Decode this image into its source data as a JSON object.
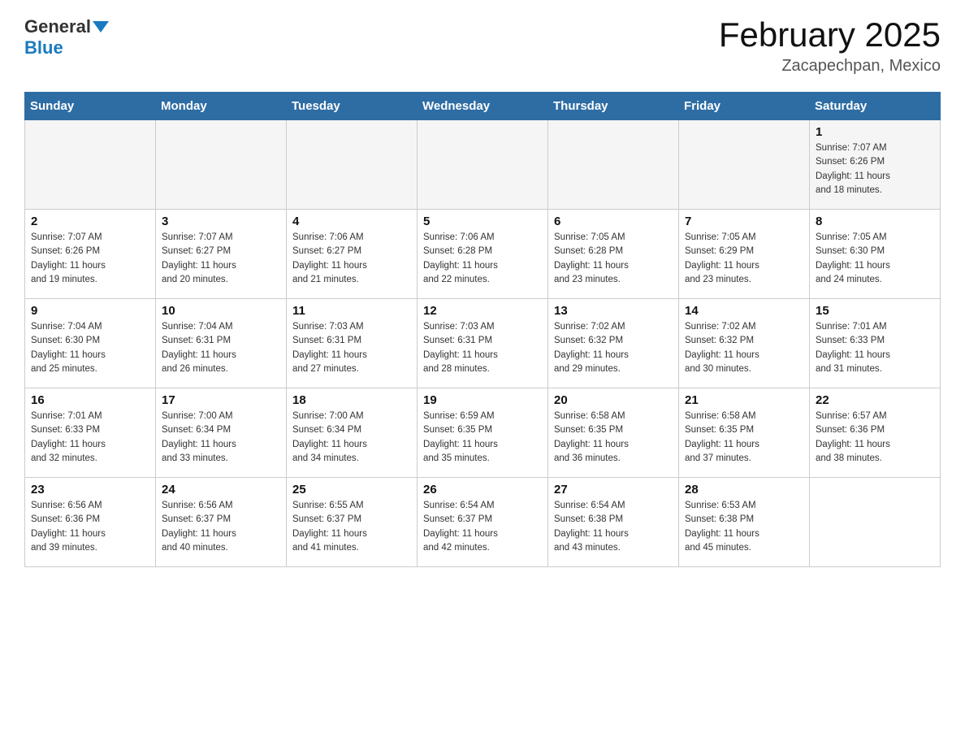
{
  "header": {
    "logo_general": "General",
    "logo_blue": "Blue",
    "month_title": "February 2025",
    "location": "Zacapechpan, Mexico"
  },
  "weekdays": [
    "Sunday",
    "Monday",
    "Tuesday",
    "Wednesday",
    "Thursday",
    "Friday",
    "Saturday"
  ],
  "weeks": [
    [
      {
        "day": "",
        "info": ""
      },
      {
        "day": "",
        "info": ""
      },
      {
        "day": "",
        "info": ""
      },
      {
        "day": "",
        "info": ""
      },
      {
        "day": "",
        "info": ""
      },
      {
        "day": "",
        "info": ""
      },
      {
        "day": "1",
        "info": "Sunrise: 7:07 AM\nSunset: 6:26 PM\nDaylight: 11 hours\nand 18 minutes."
      }
    ],
    [
      {
        "day": "2",
        "info": "Sunrise: 7:07 AM\nSunset: 6:26 PM\nDaylight: 11 hours\nand 19 minutes."
      },
      {
        "day": "3",
        "info": "Sunrise: 7:07 AM\nSunset: 6:27 PM\nDaylight: 11 hours\nand 20 minutes."
      },
      {
        "day": "4",
        "info": "Sunrise: 7:06 AM\nSunset: 6:27 PM\nDaylight: 11 hours\nand 21 minutes."
      },
      {
        "day": "5",
        "info": "Sunrise: 7:06 AM\nSunset: 6:28 PM\nDaylight: 11 hours\nand 22 minutes."
      },
      {
        "day": "6",
        "info": "Sunrise: 7:05 AM\nSunset: 6:28 PM\nDaylight: 11 hours\nand 23 minutes."
      },
      {
        "day": "7",
        "info": "Sunrise: 7:05 AM\nSunset: 6:29 PM\nDaylight: 11 hours\nand 23 minutes."
      },
      {
        "day": "8",
        "info": "Sunrise: 7:05 AM\nSunset: 6:30 PM\nDaylight: 11 hours\nand 24 minutes."
      }
    ],
    [
      {
        "day": "9",
        "info": "Sunrise: 7:04 AM\nSunset: 6:30 PM\nDaylight: 11 hours\nand 25 minutes."
      },
      {
        "day": "10",
        "info": "Sunrise: 7:04 AM\nSunset: 6:31 PM\nDaylight: 11 hours\nand 26 minutes."
      },
      {
        "day": "11",
        "info": "Sunrise: 7:03 AM\nSunset: 6:31 PM\nDaylight: 11 hours\nand 27 minutes."
      },
      {
        "day": "12",
        "info": "Sunrise: 7:03 AM\nSunset: 6:31 PM\nDaylight: 11 hours\nand 28 minutes."
      },
      {
        "day": "13",
        "info": "Sunrise: 7:02 AM\nSunset: 6:32 PM\nDaylight: 11 hours\nand 29 minutes."
      },
      {
        "day": "14",
        "info": "Sunrise: 7:02 AM\nSunset: 6:32 PM\nDaylight: 11 hours\nand 30 minutes."
      },
      {
        "day": "15",
        "info": "Sunrise: 7:01 AM\nSunset: 6:33 PM\nDaylight: 11 hours\nand 31 minutes."
      }
    ],
    [
      {
        "day": "16",
        "info": "Sunrise: 7:01 AM\nSunset: 6:33 PM\nDaylight: 11 hours\nand 32 minutes."
      },
      {
        "day": "17",
        "info": "Sunrise: 7:00 AM\nSunset: 6:34 PM\nDaylight: 11 hours\nand 33 minutes."
      },
      {
        "day": "18",
        "info": "Sunrise: 7:00 AM\nSunset: 6:34 PM\nDaylight: 11 hours\nand 34 minutes."
      },
      {
        "day": "19",
        "info": "Sunrise: 6:59 AM\nSunset: 6:35 PM\nDaylight: 11 hours\nand 35 minutes."
      },
      {
        "day": "20",
        "info": "Sunrise: 6:58 AM\nSunset: 6:35 PM\nDaylight: 11 hours\nand 36 minutes."
      },
      {
        "day": "21",
        "info": "Sunrise: 6:58 AM\nSunset: 6:35 PM\nDaylight: 11 hours\nand 37 minutes."
      },
      {
        "day": "22",
        "info": "Sunrise: 6:57 AM\nSunset: 6:36 PM\nDaylight: 11 hours\nand 38 minutes."
      }
    ],
    [
      {
        "day": "23",
        "info": "Sunrise: 6:56 AM\nSunset: 6:36 PM\nDaylight: 11 hours\nand 39 minutes."
      },
      {
        "day": "24",
        "info": "Sunrise: 6:56 AM\nSunset: 6:37 PM\nDaylight: 11 hours\nand 40 minutes."
      },
      {
        "day": "25",
        "info": "Sunrise: 6:55 AM\nSunset: 6:37 PM\nDaylight: 11 hours\nand 41 minutes."
      },
      {
        "day": "26",
        "info": "Sunrise: 6:54 AM\nSunset: 6:37 PM\nDaylight: 11 hours\nand 42 minutes."
      },
      {
        "day": "27",
        "info": "Sunrise: 6:54 AM\nSunset: 6:38 PM\nDaylight: 11 hours\nand 43 minutes."
      },
      {
        "day": "28",
        "info": "Sunrise: 6:53 AM\nSunset: 6:38 PM\nDaylight: 11 hours\nand 45 minutes."
      },
      {
        "day": "",
        "info": ""
      }
    ]
  ]
}
